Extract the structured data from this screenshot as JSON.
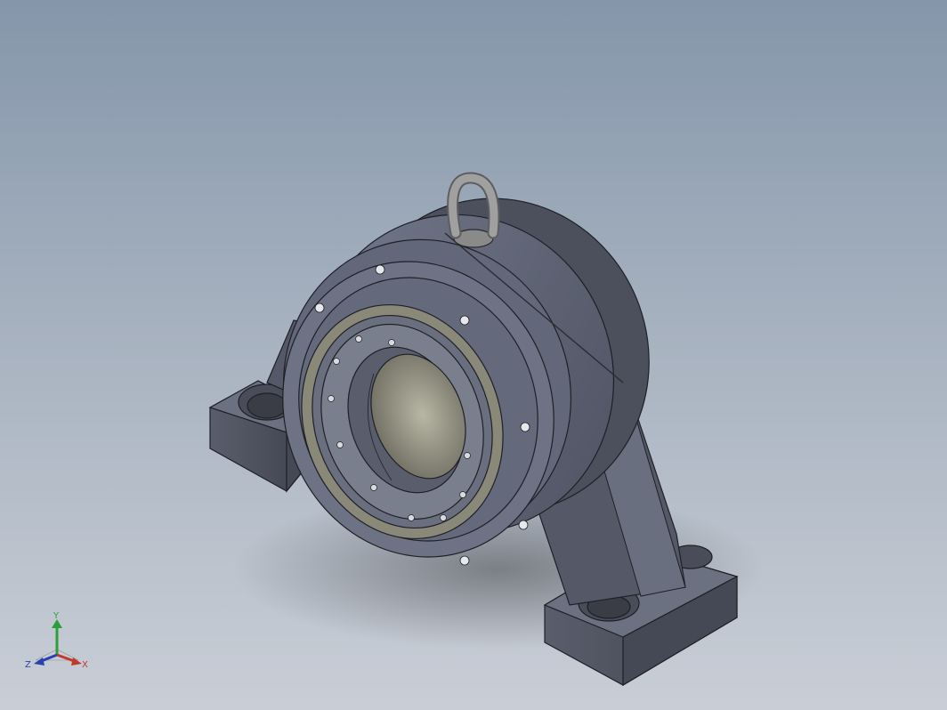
{
  "triad": {
    "y_label": "Y",
    "z_label": "Z",
    "x_label": "X",
    "colors": {
      "x": "#c0392b",
      "y": "#2e9e3a",
      "z": "#2b3fb0"
    }
  },
  "model": {
    "colors": {
      "body": "#5c6070",
      "body_light": "#6f7486",
      "body_dark": "#3d404b",
      "edge": "#1e2026",
      "seal": "#8a8878",
      "bore": "#a09e8c",
      "eyebolt": "#8f8f8f"
    }
  }
}
